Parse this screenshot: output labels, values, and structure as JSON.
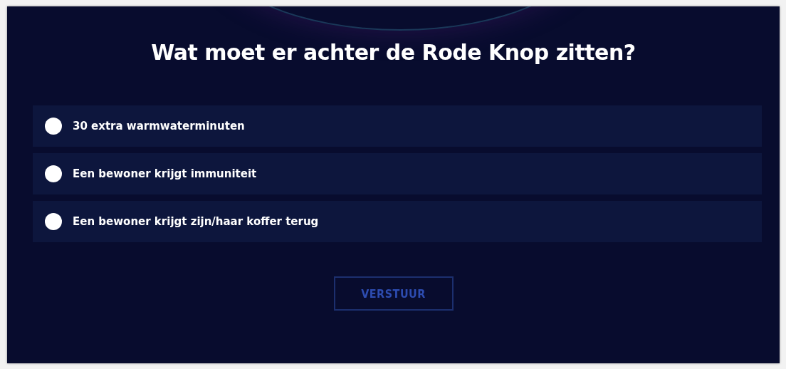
{
  "question": {
    "title": "Wat moet er achter de Rode Knop zitten?"
  },
  "options": [
    {
      "label": "30 extra warmwaterminuten",
      "selected": false
    },
    {
      "label": "Een bewoner krijgt immuniteit",
      "selected": false
    },
    {
      "label": "Een bewoner krijgt zijn/haar koffer terug",
      "selected": false
    }
  ],
  "submit": {
    "label": "VERSTUUR",
    "disabled": true
  }
}
